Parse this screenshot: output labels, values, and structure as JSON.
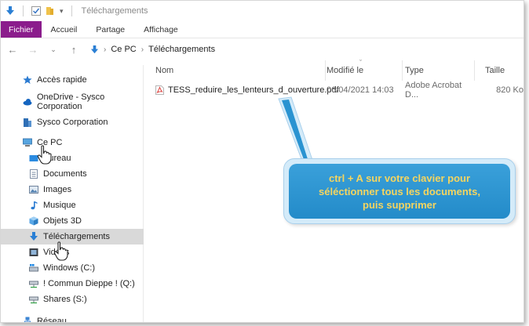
{
  "window": {
    "title": "Téléchargements"
  },
  "ribbon": {
    "tabs": [
      "Fichier",
      "Accueil",
      "Partage",
      "Affichage"
    ]
  },
  "address": {
    "path": [
      "Ce PC",
      "Téléchargements"
    ]
  },
  "sidebar": {
    "items": [
      {
        "label": "Accès rapide",
        "icon": "star-icon"
      },
      {
        "label": "OneDrive - Sysco Corporation",
        "icon": "cloud-icon"
      },
      {
        "label": "Sysco Corporation",
        "icon": "building-icon"
      },
      {
        "label": "Ce PC",
        "icon": "computer-icon"
      },
      {
        "label": "Bureau",
        "icon": "desktop-icon"
      },
      {
        "label": "Documents",
        "icon": "documents-icon"
      },
      {
        "label": "Images",
        "icon": "images-icon"
      },
      {
        "label": "Musique",
        "icon": "music-icon"
      },
      {
        "label": "Objets 3D",
        "icon": "cube-icon"
      },
      {
        "label": "Téléchargements",
        "icon": "download-icon",
        "selected": true
      },
      {
        "label": "Vidéos",
        "icon": "video-icon"
      },
      {
        "label": "Windows (C:)",
        "icon": "drive-icon"
      },
      {
        "label": "! Commun Dieppe ! (Q:)",
        "icon": "network-drive-icon"
      },
      {
        "label": "Shares (S:)",
        "icon": "network-drive-icon"
      },
      {
        "label": "Réseau",
        "icon": "network-icon"
      }
    ]
  },
  "columns": {
    "name": "Nom",
    "modified": "Modifié le",
    "type": "Type",
    "size": "Taille"
  },
  "files": [
    {
      "name": "TESS_reduire_les_lenteurs_d_ouverture.pdf",
      "modified": "06/04/2021 14:03",
      "type": "Adobe Acrobat D...",
      "size": "820 Ko",
      "icon": "pdf-icon"
    }
  ],
  "callout": {
    "line1": "ctrl + A  sur votre clavier pour",
    "line2": "séléctionner tous les documents,",
    "line3": "puis supprimer"
  },
  "colors": {
    "file_tab": "#8b1c8c",
    "callout_fill": "#2a93d1",
    "callout_text": "#f5d55f",
    "selected_item": "#d9d9d9"
  }
}
